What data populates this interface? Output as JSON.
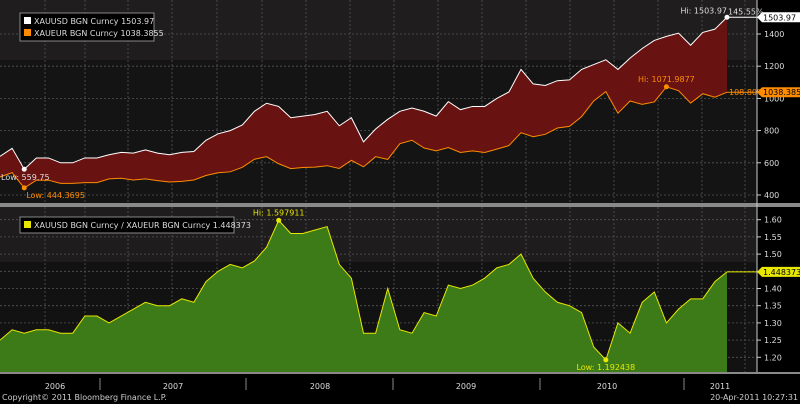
{
  "chart_data": [
    {
      "type": "area",
      "panel": "top",
      "x_start": "2006-04",
      "x_end": "2011-04",
      "x_step": "month",
      "ylim": [
        350,
        1560
      ],
      "yticks": [
        400,
        600,
        800,
        1000,
        1200,
        1400
      ],
      "grid": true,
      "legend_placement": "top-left",
      "series": [
        {
          "name": "XAUUSD BGN Curncy",
          "last": "1503.97",
          "color": "#ffffff",
          "values": [
            640,
            690,
            560,
            630,
            630,
            600,
            600,
            630,
            630,
            650,
            665,
            660,
            680,
            660,
            650,
            665,
            670,
            740,
            780,
            800,
            835,
            920,
            970,
            950,
            880,
            890,
            900,
            920,
            830,
            880,
            730,
            810,
            870,
            920,
            940,
            920,
            890,
            980,
            930,
            950,
            950,
            1000,
            1040,
            1180,
            1090,
            1080,
            1110,
            1115,
            1180,
            1210,
            1240,
            1180,
            1250,
            1310,
            1360,
            1385,
            1405,
            1330,
            1410,
            1430,
            1503.97
          ]
        },
        {
          "name": "XAUEUR BGN Curncy",
          "last": "1038.3855",
          "color": "#ff8c00",
          "values": [
            512,
            539,
            444,
            492,
            492,
            472,
            472,
            477,
            477,
            500,
            504,
            493,
            500,
            489,
            481,
            485,
            493,
            521,
            538,
            544,
            572,
            622,
            638,
            594,
            564,
            571,
            573,
            582,
            565,
            615,
            575,
            638,
            621,
            719,
            740,
            692,
            674,
            695,
            664,
            674,
            664,
            685,
            707,
            787,
            762,
            777,
            816,
            826,
            887,
            984,
            1042,
            908,
            984,
            963,
            978,
            1072,
            1048,
            971,
            1029,
            1007,
            1038.3855
          ]
        }
      ],
      "annotations": {
        "hi_usd": "Hi: 1503.97",
        "pct_usd": "145.55%",
        "low_usd": "Low: 559.75",
        "hi_eur": "Hi: 1071.9877",
        "pct_eur": "108.80%",
        "low_eur": "Low: 444.3695"
      },
      "fill_color": "#6e1212"
    },
    {
      "type": "area",
      "panel": "bottom",
      "x_start": "2006-04",
      "x_end": "2011-04",
      "x_step": "month",
      "ylim": [
        1.165,
        1.635
      ],
      "yticks": [
        "1.20",
        "1.25",
        "1.30",
        "1.35",
        "1.40",
        "1.45",
        "1.50",
        "1.55",
        "1.60"
      ],
      "grid": true,
      "legend_placement": "top-left",
      "series": [
        {
          "name": "XAUUSD BGN Curncy / XAUEUR BGN Curncy",
          "last": "1.448373",
          "color": "#e8e800",
          "values": [
            1.25,
            1.28,
            1.27,
            1.28,
            1.28,
            1.27,
            1.27,
            1.32,
            1.32,
            1.3,
            1.32,
            1.34,
            1.36,
            1.35,
            1.35,
            1.37,
            1.36,
            1.42,
            1.45,
            1.47,
            1.46,
            1.48,
            1.52,
            1.598,
            1.56,
            1.56,
            1.57,
            1.58,
            1.47,
            1.43,
            1.27,
            1.27,
            1.4,
            1.28,
            1.27,
            1.33,
            1.32,
            1.41,
            1.4,
            1.41,
            1.43,
            1.46,
            1.47,
            1.5,
            1.43,
            1.39,
            1.36,
            1.35,
            1.33,
            1.23,
            1.192438,
            1.3,
            1.27,
            1.36,
            1.39,
            1.3,
            1.34,
            1.37,
            1.37,
            1.42,
            1.448373
          ]
        }
      ],
      "annotations": {
        "hi": "Hi: 1.597911",
        "low": "Low: 1.192438"
      },
      "fill_color": "#3d7a18"
    }
  ],
  "xaxis": {
    "years": [
      "2006",
      "2007",
      "2008",
      "2009",
      "2010",
      "2011"
    ]
  },
  "footer": {
    "copyright": "Copyright© 2011 Bloomberg Finance L.P.",
    "timestamp": "20-Apr-2011 10:27:31"
  }
}
